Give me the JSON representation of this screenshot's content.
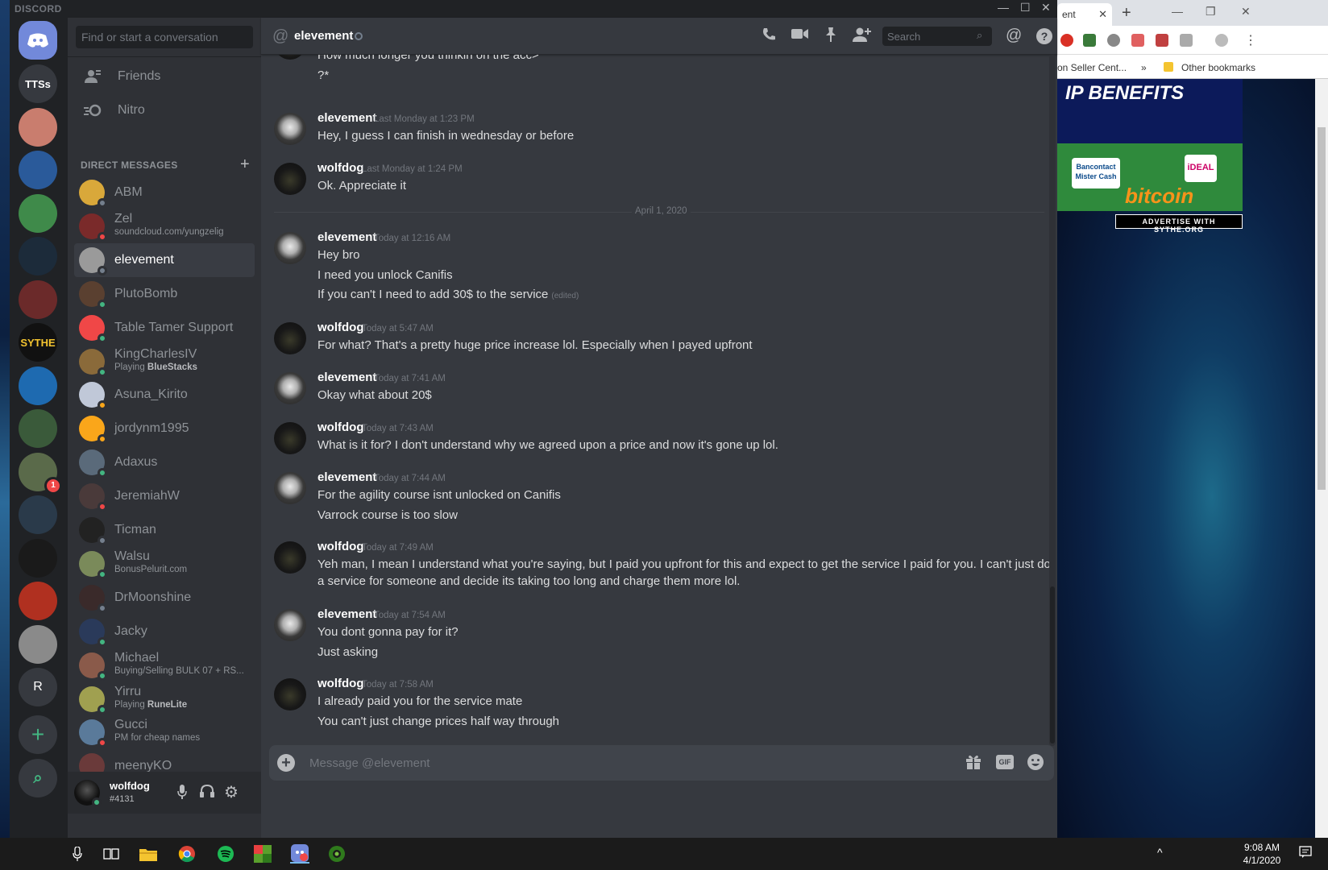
{
  "browser": {
    "tab_label": "ent",
    "bookmarks": [
      "on Seller Cent...",
      "»",
      "Other bookmarks"
    ],
    "ads": {
      "banner_text": "IP BENEFITS",
      "bancontact": "Bancontact Mister Cash",
      "ideal": "iDEAL",
      "bitcoin": "bitcoin",
      "advertise": "ADVERTISE WITH SYTHE.ORG"
    }
  },
  "titlebar": {
    "brand": "DISCORD"
  },
  "servers": [
    {
      "label": "TTSs",
      "color": "#36393f"
    },
    {
      "label": "",
      "color": "#c97d6e"
    },
    {
      "label": "",
      "color": "#2a5a9a"
    },
    {
      "label": "",
      "color": "#3f8a4a"
    },
    {
      "label": "",
      "color": "#1c2b3a"
    },
    {
      "label": "",
      "color": "#6b2a2a"
    },
    {
      "label": "SYTHE",
      "color": "#111111"
    },
    {
      "label": "",
      "color": "#1e6ab0"
    },
    {
      "label": "",
      "color": "#3a5a3a"
    },
    {
      "label": "",
      "color": "#5a6a4a",
      "badge": "1"
    },
    {
      "label": "",
      "color": "#2a3a4a"
    },
    {
      "label": "",
      "color": "#1a1a1a"
    },
    {
      "label": "",
      "color": "#b03020"
    },
    {
      "label": "",
      "color": "#8a8a8a"
    },
    {
      "label": "R",
      "color": "#36393f"
    }
  ],
  "sidebar": {
    "search_placeholder": "Find or start a conversation",
    "nav": [
      {
        "label": "Friends"
      },
      {
        "label": "Nitro"
      }
    ],
    "dm_header": "DIRECT MESSAGES",
    "dms": [
      {
        "name": "ABM",
        "status": "off",
        "avatar": "#d9a83a"
      },
      {
        "name": "Zel",
        "sub": "soundcloud.com/yungzelig",
        "status": "dnd",
        "avatar": "#7a2a2a"
      },
      {
        "name": "elevement",
        "status": "off",
        "avatar": "#9a9a9a",
        "active": true
      },
      {
        "name": "PlutoBomb",
        "status": "online",
        "avatar": "#5a4030"
      },
      {
        "name": "Table Tamer Support",
        "status": "online",
        "avatar": "#f04747"
      },
      {
        "name": "KingCharlesIV",
        "sub_prefix": "Playing ",
        "sub_bold": "BlueStacks",
        "status": "online",
        "avatar": "#8a6a3a"
      },
      {
        "name": "Asuna_Kirito",
        "status": "idle",
        "avatar": "#c0c8d8"
      },
      {
        "name": "jordynm1995",
        "status": "idle",
        "avatar": "#faa61a"
      },
      {
        "name": "Adaxus",
        "status": "online",
        "avatar": "#5a6a7a"
      },
      {
        "name": "JeremiahW",
        "status": "dnd",
        "avatar": "#4a3a3a"
      },
      {
        "name": "Ticman",
        "status": "off",
        "avatar": "#222222"
      },
      {
        "name": "Walsu",
        "sub": "BonusPelurit.com",
        "status": "online",
        "avatar": "#7a8a5a"
      },
      {
        "name": "DrMoonshine",
        "status": "off",
        "avatar": "#3a2a2a"
      },
      {
        "name": "Jacky",
        "status": "online",
        "avatar": "#2a3a5a"
      },
      {
        "name": "Michael",
        "sub": "Buying/Selling BULK 07 + RS...",
        "status": "online",
        "avatar": "#8a5a4a"
      },
      {
        "name": "Yirru",
        "sub_prefix": "Playing ",
        "sub_bold": "RuneLite",
        "status": "online",
        "avatar": "#a0a050"
      },
      {
        "name": "Gucci",
        "sub": "PM for cheap names",
        "status": "dnd",
        "avatar": "#5a7a9a"
      },
      {
        "name": "meenyKO",
        "status": "online",
        "avatar": "#6a3a3a"
      }
    ],
    "user": {
      "name": "wolfdog",
      "tag": "#4131"
    }
  },
  "chat": {
    "channel": "elevement",
    "search_placeholder": "Search",
    "composer_placeholder": "Message @elevement",
    "date_divider": "April 1, 2020",
    "messages": [
      {
        "avatar": "wolf",
        "lines": [
          "How much longer you thinkin on the acc>",
          "?*"
        ]
      },
      {
        "author": "elevement",
        "avatar": "elev",
        "time": "Last Monday at 1:23 PM",
        "lines": [
          "Hey, I guess I can finish in wednesday or before"
        ]
      },
      {
        "author": "wolfdog",
        "avatar": "wolf",
        "time": "Last Monday at 1:24 PM",
        "lines": [
          "Ok. Appreciate it"
        ]
      },
      {
        "author": "elevement",
        "avatar": "elev",
        "time": "Today at 12:16 AM",
        "lines": [
          "Hey bro",
          "I need you unlock Canifis",
          "If you can't I need to add 30$ to the service"
        ],
        "edited": "(edited)"
      },
      {
        "author": "wolfdog",
        "avatar": "wolf",
        "time": "Today at 5:47 AM",
        "lines": [
          "For what? That's a pretty huge price increase lol. Especially when I payed upfront"
        ]
      },
      {
        "author": "elevement",
        "avatar": "elev",
        "time": "Today at 7:41 AM",
        "lines": [
          "Okay what about 20$"
        ]
      },
      {
        "author": "wolfdog",
        "avatar": "wolf",
        "time": "Today at 7:43 AM",
        "lines": [
          "What is it for? I don't understand why we agreed upon a price and now it's gone up lol."
        ]
      },
      {
        "author": "elevement",
        "avatar": "elev",
        "time": "Today at 7:44 AM",
        "lines": [
          "For the agility course isnt unlocked on Canifis",
          "Varrock course is too slow"
        ]
      },
      {
        "author": "wolfdog",
        "avatar": "wolf",
        "time": "Today at 7:49 AM",
        "lines": [
          "Yeh man, I mean I understand what you're saying, but I paid you upfront for this and expect to get the service I paid for you. I can't just do",
          "a service for someone and decide its taking too long and charge them more lol."
        ]
      },
      {
        "author": "elevement",
        "avatar": "elev",
        "time": "Today at 7:54 AM",
        "lines": [
          "You dont gonna pay for it?",
          "Just asking"
        ]
      },
      {
        "author": "wolfdog",
        "avatar": "wolf",
        "time": "Today at 7:58 AM",
        "lines": [
          "I already paid you for the service mate",
          "You can't just change prices half way through"
        ]
      }
    ]
  },
  "taskbar": {
    "time": "9:08 AM",
    "date": "4/1/2020"
  }
}
